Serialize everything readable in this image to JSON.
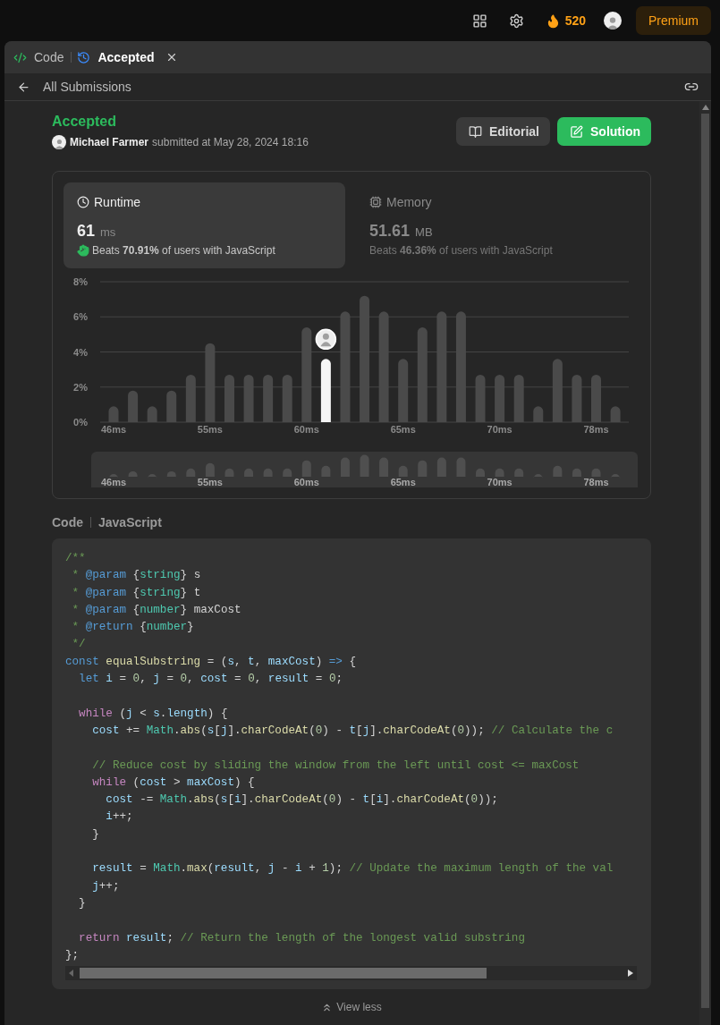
{
  "top_bar": {
    "streak": "520",
    "premium": "Premium"
  },
  "tabs": [
    {
      "label": "Code",
      "selected": false
    },
    {
      "label": "Accepted",
      "selected": true,
      "closable": true
    }
  ],
  "nav": {
    "back": "All Submissions"
  },
  "submission": {
    "status": "Accepted",
    "author": "Michael Farmer",
    "submitted": "submitted at May 28, 2024 18:16"
  },
  "actions": [
    {
      "label": "Editorial",
      "kind": "secondary"
    },
    {
      "label": "Solution",
      "kind": "primary"
    }
  ],
  "metrics": [
    {
      "label": "Runtime",
      "value": "61",
      "unit": "ms",
      "beats": "Beats **70.91%** of users with JavaScript",
      "selected": true
    },
    {
      "label": "Memory",
      "value": "51.61",
      "unit": "MB",
      "beats": "Beats **46.36%** of users with JavaScript",
      "selected": false
    }
  ],
  "runtime_chart": {
    "chart_data": {
      "type": "bar",
      "grid": true,
      "categories": [
        "46ms",
        null,
        null,
        null,
        null,
        "55ms",
        null,
        null,
        null,
        null,
        "60ms",
        null,
        null,
        null,
        null,
        "65ms",
        null,
        null,
        null,
        null,
        "70ms",
        null,
        null,
        null,
        null,
        "78ms",
        null
      ],
      "values": [
        0.9,
        1.8,
        0.9,
        1.8,
        2.7,
        4.5,
        2.7,
        2.7,
        2.7,
        2.7,
        5.4,
        3.6,
        6.3,
        7.2,
        6.3,
        3.6,
        5.4,
        6.3,
        6.3,
        2.7,
        2.7,
        2.7,
        0.9,
        3.6,
        2.7,
        2.7,
        0.9
      ],
      "ylim": [
        0,
        8
      ],
      "yticks": [
        {
          "value": 0,
          "label": "0%"
        },
        {
          "value": 2,
          "label": "2%"
        },
        {
          "value": 4,
          "label": "4%"
        },
        {
          "value": 6,
          "label": "6%"
        },
        {
          "value": 8,
          "label": "8%"
        }
      ]
    },
    "bars": [
      {
        "selected": false
      },
      {
        "selected": false
      },
      {
        "selected": false
      },
      {
        "selected": false
      },
      {
        "selected": false
      },
      {
        "selected": false
      },
      {
        "selected": false
      },
      {
        "selected": false
      },
      {
        "selected": false
      },
      {
        "selected": false
      },
      {
        "selected": false
      },
      {
        "selected": true
      },
      {
        "selected": false
      },
      {
        "selected": false
      },
      {
        "selected": false
      },
      {
        "selected": false
      },
      {
        "selected": false
      },
      {
        "selected": false
      },
      {
        "selected": false
      },
      {
        "selected": false
      },
      {
        "selected": false
      },
      {
        "selected": false
      },
      {
        "selected": false
      },
      {
        "selected": false
      },
      {
        "selected": false
      },
      {
        "selected": false
      },
      {
        "selected": false
      }
    ],
    "overview_labels": [
      "46ms",
      "55ms",
      "60ms",
      "65ms",
      "70ms",
      "78ms"
    ]
  },
  "code_header": {
    "title": "Code",
    "language": "JavaScript"
  },
  "code_lines": [
    {
      "kind": "code",
      "tokens": [
        {
          "kind": "comment",
          "text": "/**"
        }
      ]
    },
    {
      "kind": "code",
      "tokens": [
        {
          "kind": "comment",
          "text": " * "
        },
        {
          "kind": "keyword",
          "text": "@param"
        },
        {
          "kind": "plain",
          "text": " {"
        },
        {
          "kind": "type",
          "text": "string"
        },
        {
          "kind": "plain",
          "text": "} s"
        }
      ]
    },
    {
      "kind": "code",
      "tokens": [
        {
          "kind": "comment",
          "text": " * "
        },
        {
          "kind": "keyword",
          "text": "@param"
        },
        {
          "kind": "plain",
          "text": " {"
        },
        {
          "kind": "type",
          "text": "string"
        },
        {
          "kind": "plain",
          "text": "} t"
        }
      ]
    },
    {
      "kind": "code",
      "tokens": [
        {
          "kind": "comment",
          "text": " * "
        },
        {
          "kind": "keyword",
          "text": "@param"
        },
        {
          "kind": "plain",
          "text": " {"
        },
        {
          "kind": "type",
          "text": "number"
        },
        {
          "kind": "plain",
          "text": "} maxCost"
        }
      ]
    },
    {
      "kind": "code",
      "tokens": [
        {
          "kind": "comment",
          "text": " * "
        },
        {
          "kind": "keyword",
          "text": "@return"
        },
        {
          "kind": "plain",
          "text": " {"
        },
        {
          "kind": "type",
          "text": "number"
        },
        {
          "kind": "plain",
          "text": "}"
        }
      ]
    },
    {
      "kind": "code",
      "tokens": [
        {
          "kind": "comment",
          "text": " */"
        }
      ]
    },
    {
      "kind": "code",
      "tokens": [
        {
          "kind": "keyword",
          "text": "const "
        },
        {
          "kind": "function",
          "text": "equalSubstring"
        },
        {
          "kind": "plain",
          "text": " = ("
        },
        {
          "kind": "variable",
          "text": "s"
        },
        {
          "kind": "plain",
          "text": ", "
        },
        {
          "kind": "variable",
          "text": "t"
        },
        {
          "kind": "plain",
          "text": ", "
        },
        {
          "kind": "variable",
          "text": "maxCost"
        },
        {
          "kind": "plain",
          "text": ") "
        },
        {
          "kind": "keyword",
          "text": "=>"
        },
        {
          "kind": "plain",
          "text": " {"
        }
      ]
    },
    {
      "kind": "code",
      "tokens": [
        {
          "kind": "keyword",
          "text": "  let "
        },
        {
          "kind": "variable",
          "text": "i"
        },
        {
          "kind": "plain",
          "text": " = "
        },
        {
          "kind": "number",
          "text": "0"
        },
        {
          "kind": "plain",
          "text": ", "
        },
        {
          "kind": "variable",
          "text": "j"
        },
        {
          "kind": "plain",
          "text": " = "
        },
        {
          "kind": "number",
          "text": "0"
        },
        {
          "kind": "plain",
          "text": ", "
        },
        {
          "kind": "variable",
          "text": "cost"
        },
        {
          "kind": "plain",
          "text": " = "
        },
        {
          "kind": "number",
          "text": "0"
        },
        {
          "kind": "plain",
          "text": ", "
        },
        {
          "kind": "variable",
          "text": "result"
        },
        {
          "kind": "plain",
          "text": " = "
        },
        {
          "kind": "number",
          "text": "0"
        },
        {
          "kind": "plain",
          "text": ";"
        }
      ]
    },
    {
      "kind": "blank"
    },
    {
      "kind": "code",
      "tokens": [
        {
          "kind": "control",
          "text": "  while"
        },
        {
          "kind": "plain",
          "text": " ("
        },
        {
          "kind": "variable",
          "text": "j"
        },
        {
          "kind": "plain",
          "text": " < "
        },
        {
          "kind": "variable",
          "text": "s"
        },
        {
          "kind": "plain",
          "text": "."
        },
        {
          "kind": "variable",
          "text": "length"
        },
        {
          "kind": "plain",
          "text": ") {"
        }
      ]
    },
    {
      "kind": "code",
      "tokens": [
        {
          "kind": "variable",
          "text": "    cost"
        },
        {
          "kind": "plain",
          "text": " += "
        },
        {
          "kind": "class",
          "text": "Math"
        },
        {
          "kind": "plain",
          "text": "."
        },
        {
          "kind": "function",
          "text": "abs"
        },
        {
          "kind": "plain",
          "text": "("
        },
        {
          "kind": "variable",
          "text": "s"
        },
        {
          "kind": "plain",
          "text": "["
        },
        {
          "kind": "variable",
          "text": "j"
        },
        {
          "kind": "plain",
          "text": "]."
        },
        {
          "kind": "function",
          "text": "charCodeAt"
        },
        {
          "kind": "plain",
          "text": "("
        },
        {
          "kind": "number",
          "text": "0"
        },
        {
          "kind": "plain",
          "text": ") - "
        },
        {
          "kind": "variable",
          "text": "t"
        },
        {
          "kind": "plain",
          "text": "["
        },
        {
          "kind": "variable",
          "text": "j"
        },
        {
          "kind": "plain",
          "text": "]."
        },
        {
          "kind": "function",
          "text": "charCodeAt"
        },
        {
          "kind": "plain",
          "text": "("
        },
        {
          "kind": "number",
          "text": "0"
        },
        {
          "kind": "plain",
          "text": "));"
        },
        {
          "kind": "comment",
          "text": " // Calculate the c"
        }
      ]
    },
    {
      "kind": "blank"
    },
    {
      "kind": "code",
      "tokens": [
        {
          "kind": "comment",
          "text": "    // Reduce cost by sliding the window from the left until cost <= maxCost"
        }
      ]
    },
    {
      "kind": "code",
      "tokens": [
        {
          "kind": "control",
          "text": "    while"
        },
        {
          "kind": "plain",
          "text": " ("
        },
        {
          "kind": "variable",
          "text": "cost"
        },
        {
          "kind": "plain",
          "text": " > "
        },
        {
          "kind": "variable",
          "text": "maxCost"
        },
        {
          "kind": "plain",
          "text": ") {"
        }
      ]
    },
    {
      "kind": "code",
      "tokens": [
        {
          "kind": "variable",
          "text": "      cost"
        },
        {
          "kind": "plain",
          "text": " -= "
        },
        {
          "kind": "class",
          "text": "Math"
        },
        {
          "kind": "plain",
          "text": "."
        },
        {
          "kind": "function",
          "text": "abs"
        },
        {
          "kind": "plain",
          "text": "("
        },
        {
          "kind": "variable",
          "text": "s"
        },
        {
          "kind": "plain",
          "text": "["
        },
        {
          "kind": "variable",
          "text": "i"
        },
        {
          "kind": "plain",
          "text": "]."
        },
        {
          "kind": "function",
          "text": "charCodeAt"
        },
        {
          "kind": "plain",
          "text": "("
        },
        {
          "kind": "number",
          "text": "0"
        },
        {
          "kind": "plain",
          "text": ") - "
        },
        {
          "kind": "variable",
          "text": "t"
        },
        {
          "kind": "plain",
          "text": "["
        },
        {
          "kind": "variable",
          "text": "i"
        },
        {
          "kind": "plain",
          "text": "]."
        },
        {
          "kind": "function",
          "text": "charCodeAt"
        },
        {
          "kind": "plain",
          "text": "("
        },
        {
          "kind": "number",
          "text": "0"
        },
        {
          "kind": "plain",
          "text": "));"
        }
      ]
    },
    {
      "kind": "code",
      "tokens": [
        {
          "kind": "variable",
          "text": "      i"
        },
        {
          "kind": "plain",
          "text": "++;"
        }
      ]
    },
    {
      "kind": "code",
      "tokens": [
        {
          "kind": "plain",
          "text": "    }"
        }
      ]
    },
    {
      "kind": "blank"
    },
    {
      "kind": "code",
      "tokens": [
        {
          "kind": "variable",
          "text": "    result"
        },
        {
          "kind": "plain",
          "text": " = "
        },
        {
          "kind": "class",
          "text": "Math"
        },
        {
          "kind": "plain",
          "text": "."
        },
        {
          "kind": "function",
          "text": "max"
        },
        {
          "kind": "plain",
          "text": "("
        },
        {
          "kind": "variable",
          "text": "result"
        },
        {
          "kind": "plain",
          "text": ", "
        },
        {
          "kind": "variable",
          "text": "j"
        },
        {
          "kind": "plain",
          "text": " - "
        },
        {
          "kind": "variable",
          "text": "i"
        },
        {
          "kind": "plain",
          "text": " + "
        },
        {
          "kind": "number",
          "text": "1"
        },
        {
          "kind": "plain",
          "text": ");"
        },
        {
          "kind": "comment",
          "text": " // Update the maximum length of the val"
        }
      ]
    },
    {
      "kind": "code",
      "tokens": [
        {
          "kind": "variable",
          "text": "    j"
        },
        {
          "kind": "plain",
          "text": "++;"
        }
      ]
    },
    {
      "kind": "code",
      "tokens": [
        {
          "kind": "plain",
          "text": "  }"
        }
      ]
    },
    {
      "kind": "blank"
    },
    {
      "kind": "code",
      "tokens": [
        {
          "kind": "control",
          "text": "  return "
        },
        {
          "kind": "variable",
          "text": "result"
        },
        {
          "kind": "plain",
          "text": ";"
        },
        {
          "kind": "comment",
          "text": " // Return the length of the longest valid substring"
        }
      ]
    },
    {
      "kind": "code",
      "tokens": [
        {
          "kind": "plain",
          "text": "};"
        }
      ]
    }
  ],
  "view_less": "View less"
}
